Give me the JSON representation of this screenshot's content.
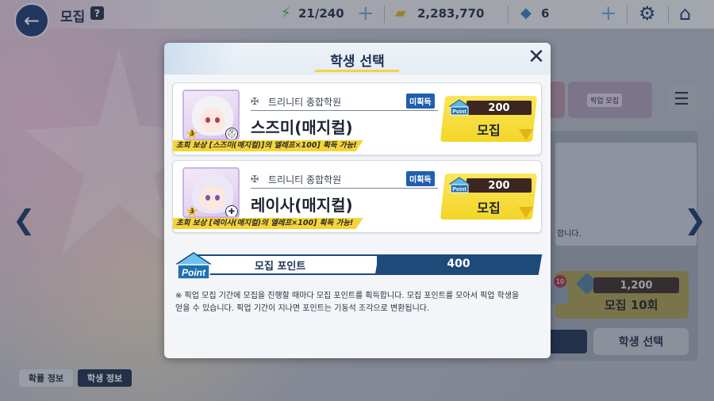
{
  "topbar": {
    "title": "모집",
    "help": "?",
    "ap": "21/240",
    "credits": "2,283,770",
    "gems": "6",
    "icons": {
      "back": "back-arrow-icon",
      "ap": "lightning-icon",
      "credits": "credit-icon",
      "gems": "pyroxene-icon",
      "settings": "gear-icon",
      "home": "home-icon"
    }
  },
  "background": {
    "pickup_label": "픽업 모집",
    "info_text": "합니다.",
    "recruit10_price": "1,200",
    "recruit10_label": "모집 10회",
    "mail_badge": "10",
    "select_student_button": "학생 선택",
    "tabs": {
      "probability": "확률 정보",
      "student_info": "학생 정보"
    }
  },
  "modal": {
    "title": "학생 선택",
    "students": [
      {
        "school": "트리니티 종합학원",
        "status": "미획득",
        "name": "스즈미(매지컬)",
        "reward": "초회 보상 [스즈미(매지컬)]의 엘레프×100] 획득 가능!",
        "price": "200",
        "recruit_label": "모집",
        "star": "3"
      },
      {
        "school": "트리니티 종합학원",
        "status": "미획득",
        "name": "레이사(매지컬)",
        "reward": "초회 보상 [레이사(매지컬)의 엘레프×100] 획득 가능!",
        "price": "200",
        "recruit_label": "모집",
        "star": "3"
      }
    ],
    "points_label": "모집 포인트",
    "points_value": "400",
    "point_icon_text": "Point",
    "notice_line1": "※ 픽업 모집 기간에 모집을 진행할 때마다 모집 포인트를 획득합니다. 모집 포인트를 모아서 픽업 학생을",
    "notice_line2": "얻을 수 있습니다. 픽업 기간이 지나면 포인트는 기동석 조각으로 변환됩니다."
  },
  "colors": {
    "navy": "#1d2f52",
    "accent_yellow": "#f4d43a",
    "badge_blue": "#1f5fb0",
    "points_bar": "#1e4a7a"
  }
}
